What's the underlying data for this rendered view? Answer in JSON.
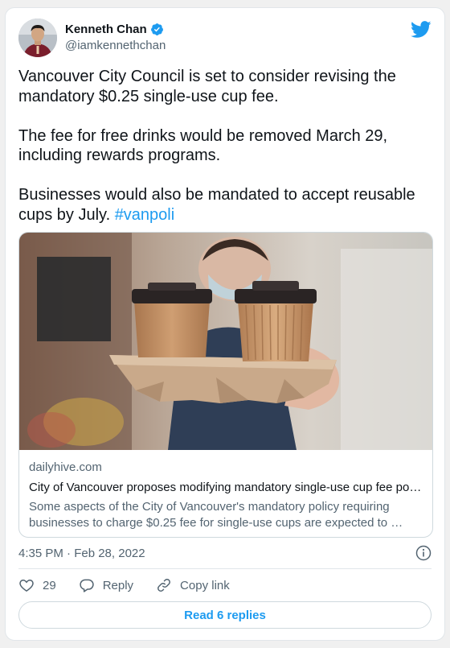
{
  "author": {
    "name": "Kenneth Chan",
    "handle": "@iamkennethchan"
  },
  "tweet": {
    "text": "Vancouver City Council is set to consider revising the mandatory $0.25 single-use cup fee.\n\nThe fee for free drinks would be removed March 29, including rewards programs.\n\nBusinesses would also be mandated to accept reusable cups by July. ",
    "hashtag": "#vanpoli"
  },
  "link_card": {
    "domain": "dailyhive.com",
    "title": "City of Vancouver proposes modifying mandatory single-use cup fee po…",
    "description": "Some aspects of the City of Vancouver's mandatory policy requiring businesses to charge $0.25 fee for single-use cups are expected to …"
  },
  "timestamp": "4:35 PM · Feb 28, 2022",
  "actions": {
    "like_count": "29",
    "reply_label": "Reply",
    "copy_link_label": "Copy link"
  },
  "read_replies_label": "Read 6 replies",
  "icons": [
    "verified-badge-icon",
    "twitter-bird-icon",
    "info-icon",
    "heart-icon",
    "reply-bubble-icon",
    "link-icon"
  ],
  "colors": {
    "brand": "#1d9bf0",
    "text": "#0f1419",
    "muted": "#536471",
    "border": "#cfd9de"
  }
}
